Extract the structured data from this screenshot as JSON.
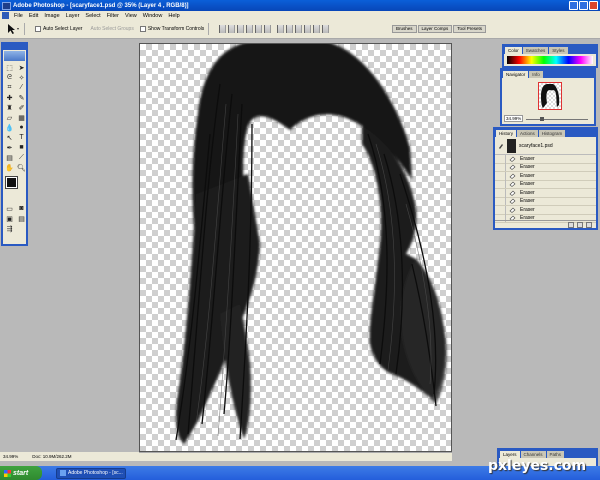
{
  "window": {
    "title": "Adobe Photoshop - [scaryface1.psd @ 35% (Layer 4 , RGB/8)]"
  },
  "menu": [
    "File",
    "Edit",
    "Image",
    "Layer",
    "Select",
    "Filter",
    "View",
    "Window",
    "Help"
  ],
  "options": {
    "auto_select_layer": "Auto Select Layer",
    "auto_select_groups": "Auto Select Groups",
    "show_transform_controls": "Show Transform Controls",
    "auto_select_layer_checked": false,
    "show_transform_controls_checked": false
  },
  "palette_well": [
    "Brushes",
    "Layer Comps",
    "Tool Presets"
  ],
  "panels": {
    "color_tabs": [
      "Color",
      "Swatches",
      "Styles"
    ],
    "navigator_tabs": [
      "Navigator",
      "Info"
    ],
    "navigator_zoom": "34.99%",
    "history_tabs": [
      "History",
      "Actions",
      "Histogram"
    ],
    "history_snapshot": "scaryface1.psd",
    "history_items": [
      "Eraser",
      "Eraser",
      "Eraser",
      "Eraser",
      "Eraser",
      "Eraser",
      "Eraser",
      "Eraser"
    ],
    "layers_tabs": [
      "Layers",
      "Channels",
      "Paths"
    ]
  },
  "status": {
    "zoom": "34.99%",
    "docs": "Doc: 10.9M/262.2M"
  },
  "taskbar": {
    "start": "start",
    "task": "Adobe Photoshop - [sc..."
  },
  "watermark": "pxleyes.com",
  "colors": {
    "xp_blue": "#2a5ac2",
    "hair": "#141414",
    "foreground": "#111111",
    "background_swatch": "#555555"
  }
}
